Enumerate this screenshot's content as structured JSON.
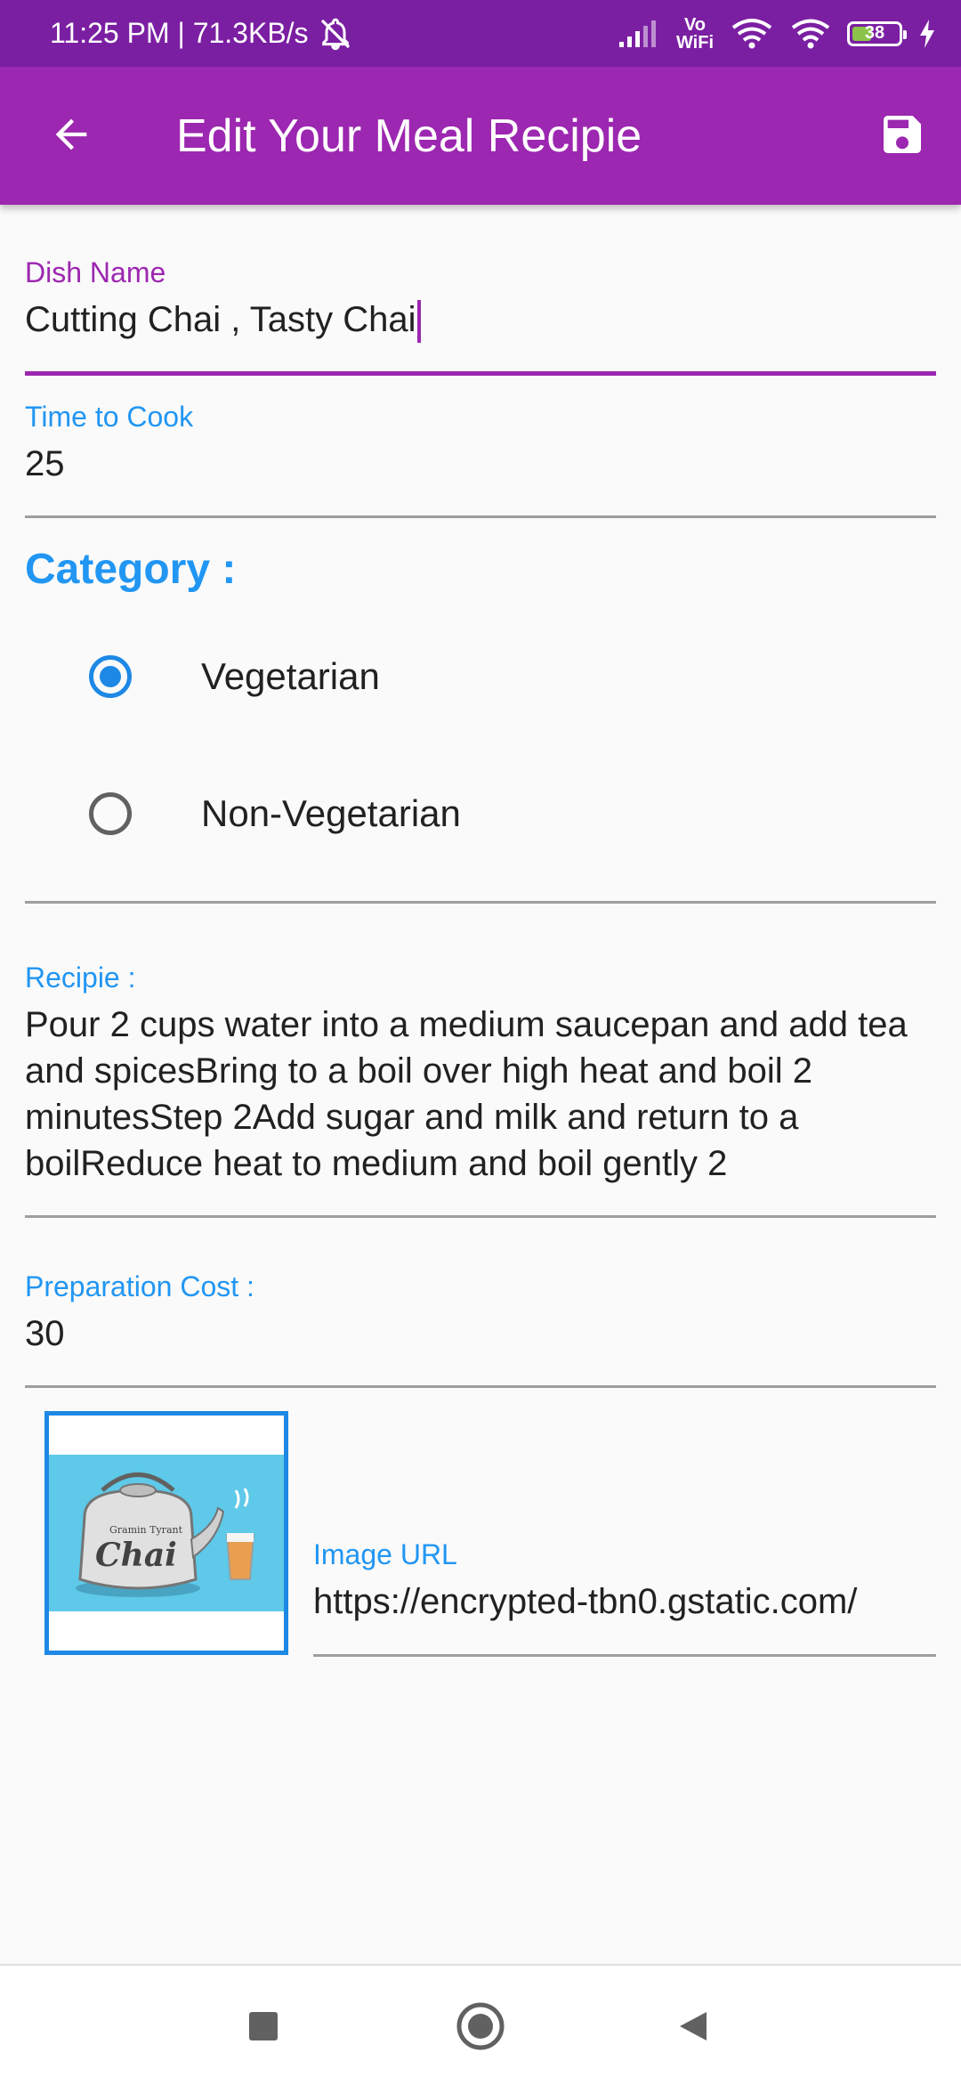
{
  "status_bar": {
    "time_speed": "11:25 PM | 71.3KB/s",
    "vowifi_top": "Vo",
    "vowifi_bottom": "WiFi",
    "battery_level": "38"
  },
  "app_bar": {
    "title": "Edit Your Meal Recipie",
    "back_icon": "arrow-back-icon",
    "save_icon": "save-icon"
  },
  "form": {
    "dish_name": {
      "label": "Dish Name",
      "value": "Cutting Chai , Tasty Chai"
    },
    "time_to_cook": {
      "label": "Time to Cook",
      "value": "25"
    },
    "category": {
      "title": "Category :",
      "options": [
        {
          "label": "Vegetarian",
          "checked": true
        },
        {
          "label": "Non-Vegetarian",
          "checked": false
        }
      ]
    },
    "recipe": {
      "label": "Recipie :",
      "value": "Pour 2 cups water into a medium saucepan and add tea and spicesBring to a boil over high heat and boil 2 minutesStep 2Add sugar and milk and return to a boilReduce heat to medium and boil gently 2"
    },
    "preparation_cost": {
      "label": "Preparation Cost :",
      "value": "30"
    },
    "image_url": {
      "label": "Image URL",
      "value": "https://encrypted-tbn0.gstatic.com/"
    }
  },
  "image": {
    "brand_small": "Gramin Tyrant",
    "brand_large": "Chai"
  },
  "colors": {
    "status_bar": "#7B1FA2",
    "app_bar": "#9C27B0",
    "accent_blue": "#2196F3",
    "radio_blue": "#1E88E5"
  },
  "nav_bar": {
    "icons": [
      "recent-apps-icon",
      "home-icon",
      "back-icon"
    ]
  }
}
